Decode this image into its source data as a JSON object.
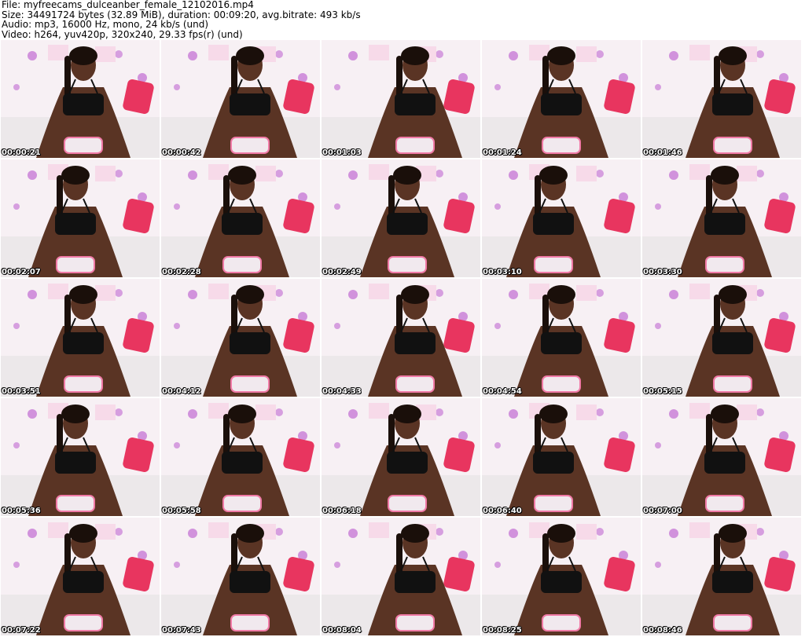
{
  "header": {
    "file_line": "File: myfreecams_dulceanber_female_12102016.mp4",
    "size_line": "Size: 34491724 bytes (32.89 MiB), duration: 00:09:20, avg.bitrate: 493 kb/s",
    "audio_line": "Audio: mp3, 16000 Hz, mono, 24 kb/s (und)",
    "video_line": "Video: h264, yuv420p, 320x240, 29.33 fps(r) (und)"
  },
  "thumbnails": [
    {
      "timestamp": "00:00:21"
    },
    {
      "timestamp": "00:00:42"
    },
    {
      "timestamp": "00:01:03"
    },
    {
      "timestamp": "00:01:24"
    },
    {
      "timestamp": "00:01:46"
    },
    {
      "timestamp": "00:02:07"
    },
    {
      "timestamp": "00:02:28"
    },
    {
      "timestamp": "00:02:49"
    },
    {
      "timestamp": "00:03:10"
    },
    {
      "timestamp": "00:03:30"
    },
    {
      "timestamp": "00:03:51"
    },
    {
      "timestamp": "00:04:12"
    },
    {
      "timestamp": "00:04:33"
    },
    {
      "timestamp": "00:04:54"
    },
    {
      "timestamp": "00:05:15"
    },
    {
      "timestamp": "00:05:36"
    },
    {
      "timestamp": "00:05:58"
    },
    {
      "timestamp": "00:06:18"
    },
    {
      "timestamp": "00:06:40"
    },
    {
      "timestamp": "00:07:00"
    },
    {
      "timestamp": "00:07:22"
    },
    {
      "timestamp": "00:07:43"
    },
    {
      "timestamp": "00:08:04"
    },
    {
      "timestamp": "00:08:25"
    },
    {
      "timestamp": "00:08:46"
    }
  ],
  "colors": {
    "background": "#ffffff",
    "wall": "#f7f0f4",
    "pillow": "#e8355f",
    "flower": "#c77ad6",
    "top": "#111111",
    "skin": "#5a3424",
    "bedding": "#ece8ea"
  }
}
